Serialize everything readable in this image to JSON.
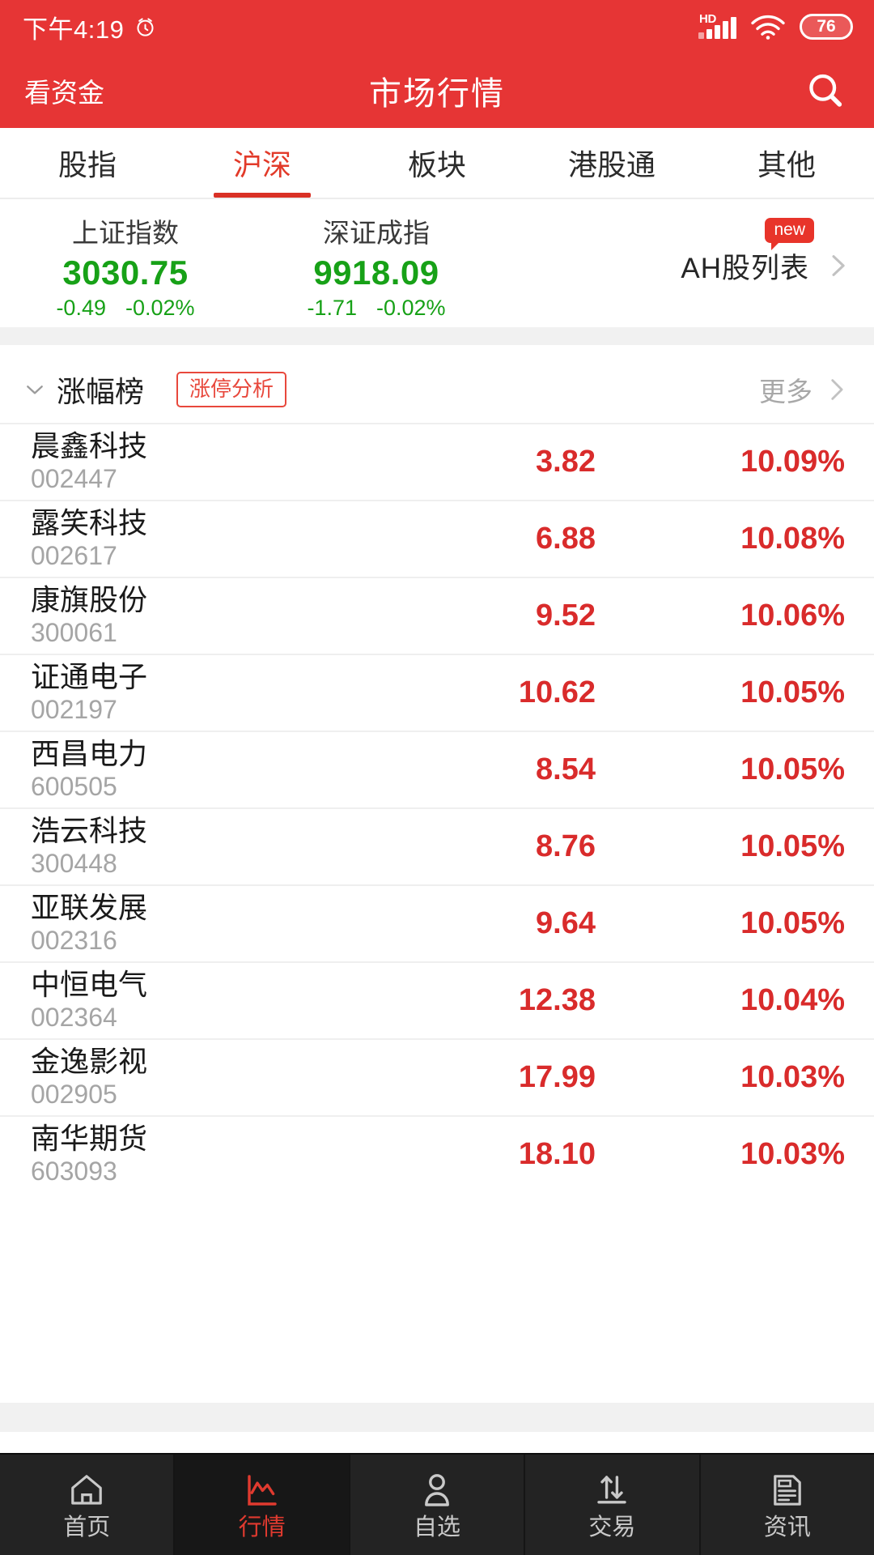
{
  "statusbar": {
    "time": "下午4:19",
    "alarm_icon": "alarm-clock-icon",
    "network_label": "HD",
    "signal_icon": "cellular-signal-icon",
    "wifi_icon": "wifi-icon",
    "battery_level": "76"
  },
  "appbar": {
    "left_label": "看资金",
    "title": "市场行情",
    "search_icon": "search-icon"
  },
  "tabs": [
    {
      "label": "股指",
      "active": false
    },
    {
      "label": "沪深",
      "active": true
    },
    {
      "label": "板块",
      "active": false
    },
    {
      "label": "港股通",
      "active": false
    },
    {
      "label": "其他",
      "active": false
    }
  ],
  "indices": [
    {
      "name": "上证指数",
      "value": "3030.75",
      "change": "-0.49",
      "change_pct": "-0.02%"
    },
    {
      "name": "深证成指",
      "value": "9918.09",
      "change": "-1.71",
      "change_pct": "-0.02%"
    }
  ],
  "ah_entry": {
    "label": "AH股列表",
    "badge": "new",
    "chevron_icon": "chevron-right-icon"
  },
  "list_header": {
    "caret_icon": "chevron-down-icon",
    "title": "涨幅榜",
    "tag_label": "涨停分析",
    "more_label": "更多",
    "more_icon": "chevron-right-icon"
  },
  "stocks": [
    {
      "name": "晨鑫科技",
      "code": "002447",
      "price": "3.82",
      "pct": "10.09%"
    },
    {
      "name": "露笑科技",
      "code": "002617",
      "price": "6.88",
      "pct": "10.08%"
    },
    {
      "name": "康旗股份",
      "code": "300061",
      "price": "9.52",
      "pct": "10.06%"
    },
    {
      "name": "证通电子",
      "code": "002197",
      "price": "10.62",
      "pct": "10.05%"
    },
    {
      "name": "西昌电力",
      "code": "600505",
      "price": "8.54",
      "pct": "10.05%"
    },
    {
      "name": "浩云科技",
      "code": "300448",
      "price": "8.76",
      "pct": "10.05%"
    },
    {
      "name": "亚联发展",
      "code": "002316",
      "price": "9.64",
      "pct": "10.05%"
    },
    {
      "name": "中恒电气",
      "code": "002364",
      "price": "12.38",
      "pct": "10.04%"
    },
    {
      "name": "金逸影视",
      "code": "002905",
      "price": "17.99",
      "pct": "10.03%"
    },
    {
      "name": "南华期货",
      "code": "603093",
      "price": "18.10",
      "pct": "10.03%"
    }
  ],
  "bottom_nav": [
    {
      "label": "首页",
      "icon": "home-icon",
      "active": false
    },
    {
      "label": "行情",
      "icon": "line-chart-icon",
      "active": true
    },
    {
      "label": "自选",
      "icon": "person-icon",
      "active": false
    },
    {
      "label": "交易",
      "icon": "transfer-icon",
      "active": false
    },
    {
      "label": "资讯",
      "icon": "news-icon",
      "active": false
    }
  ],
  "colors": {
    "brand_red": "#E63535",
    "up_red": "#D92B2B",
    "down_green": "#17A117",
    "accent_tab": "#E23A29",
    "nav_bg": "#232323"
  }
}
